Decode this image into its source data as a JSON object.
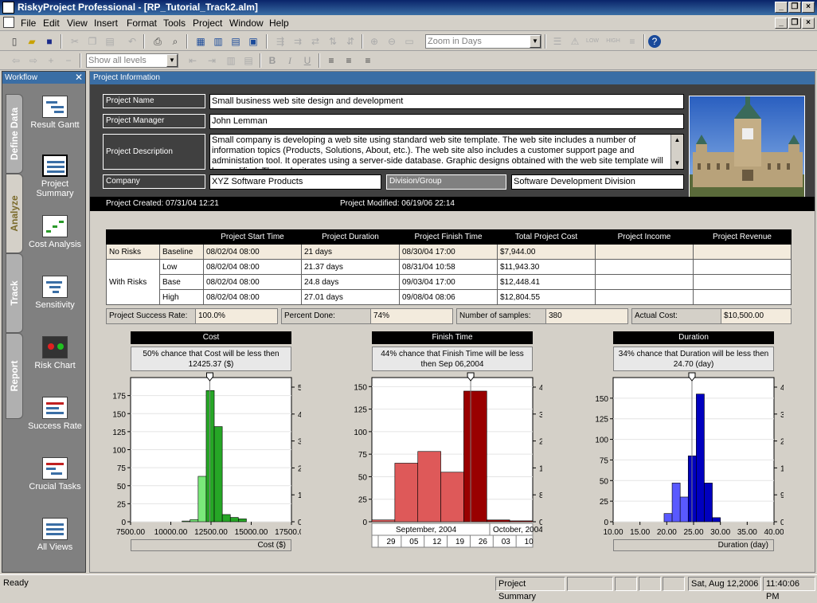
{
  "window": {
    "title": "RiskyProject Professional - [RP_Tutorial_Track2.alm]"
  },
  "menu": [
    "File",
    "Edit",
    "View",
    "Insert",
    "Format",
    "Tools",
    "Project",
    "Window",
    "Help"
  ],
  "toolbar": {
    "zoom_combo": "Zoom in Days",
    "levels_combo": "Show all levels",
    "bold": "B",
    "italic": "I",
    "underline": "U",
    "low": "LOW",
    "high": "HIGH"
  },
  "workflow": {
    "title": "Workflow",
    "tabs": [
      "Define Data",
      "Analyze",
      "Track",
      "Report"
    ],
    "items": [
      {
        "label": "Result Gantt"
      },
      {
        "label": "Project Summary"
      },
      {
        "label": "Cost Analysis"
      },
      {
        "label": "Sensitivity"
      },
      {
        "label": "Risk Chart"
      },
      {
        "label": "Success Rate"
      },
      {
        "label": "Crucial Tasks"
      },
      {
        "label": "All Views"
      }
    ]
  },
  "info": {
    "header": "Project Information",
    "project_name_label": "Project Name",
    "project_name": "Small business web site design and development",
    "manager_label": "Project Manager",
    "manager": "John Lemman",
    "description_label": "Project Description",
    "description": "Small company is developing a web site using standard web site template. The web site includes a number of information topics (Products, Solutions, About, etc.). The web site also includes a customer support page and administation tool. It operates using a server-side database. Graphic designs obtained with the web site template will be modified. The web site",
    "company_label": "Company",
    "company": "XYZ Software Products",
    "division_label": "Division/Group",
    "division": "Software Development Division",
    "created": "Project Created: 07/31/04 12:21",
    "modified": "Project Modified: 06/19/06 22:14"
  },
  "summary": {
    "headers": [
      "",
      "",
      "Project Start Time",
      "Project Duration",
      "Project Finish Time",
      "Total Project Cost",
      "Project Income",
      "Project Revenue"
    ],
    "rows": [
      {
        "group": "No Risks",
        "case": "Baseline",
        "start": "08/02/04 08:00",
        "duration": "21 days",
        "finish": "08/30/04 17:00",
        "cost": "$7,944.00",
        "income": "",
        "revenue": ""
      },
      {
        "group": "With Risks",
        "case": "Low",
        "start": "08/02/04 08:00",
        "duration": "21.37 days",
        "finish": "08/31/04 10:58",
        "cost": "$11,943.30",
        "income": "",
        "revenue": ""
      },
      {
        "group": "",
        "case": "Base",
        "start": "08/02/04 08:00",
        "duration": "24.8 days",
        "finish": "09/03/04 17:00",
        "cost": "$12,448.41",
        "income": "",
        "revenue": ""
      },
      {
        "group": "",
        "case": "High",
        "start": "08/02/04 08:00",
        "duration": "27.01 days",
        "finish": "09/08/04 08:06",
        "cost": "$12,804.55",
        "income": "",
        "revenue": ""
      }
    ]
  },
  "stats": {
    "success_label": "Project Success Rate:",
    "success": "100.0%",
    "done_label": "Percent Done:",
    "done": "74%",
    "samples_label": "Number of samples:",
    "samples": "380",
    "actual_label": "Actual Cost:",
    "actual": "$10,500.00"
  },
  "chart_data": [
    {
      "type": "bar",
      "title": "Cost",
      "note": "50% chance that Cost will be less then 12425.37 ($)",
      "xlabel": "Cost ($)",
      "x_ticks": [
        "7500.00",
        "10000.00",
        "12500.00",
        "15000.00",
        "17500.00"
      ],
      "xlim": [
        7500,
        17500
      ],
      "y_ticks": [
        "0",
        "25",
        "50",
        "75",
        "100",
        "125",
        "150",
        "175"
      ],
      "ylim": [
        0,
        200
      ],
      "y2_ticks": [
        "0%",
        "10%",
        "20%",
        "30%",
        "40%",
        "50%"
      ],
      "bins": [
        [
          10700,
          11200,
          1
        ],
        [
          11200,
          11700,
          3
        ],
        [
          11700,
          12200,
          63
        ],
        [
          12200,
          12700,
          182
        ],
        [
          12700,
          13200,
          132
        ],
        [
          13200,
          13700,
          10
        ],
        [
          13700,
          14200,
          6
        ],
        [
          14200,
          14700,
          4
        ]
      ],
      "color": "#33dd33",
      "marker": 12425
    },
    {
      "type": "bar",
      "title": "Finish Time",
      "note": "44% chance that Finish Time will be less then Sep 06,2004",
      "xlabel": "",
      "date_axis": {
        "month1": "September, 2004",
        "month2": "October, 2004",
        "days": [
          "29",
          "05",
          "12",
          "19",
          "26",
          "03",
          "10"
        ]
      },
      "y_ticks": [
        "0",
        "25",
        "50",
        "75",
        "100",
        "125",
        "150"
      ],
      "ylim": [
        0,
        160
      ],
      "y2_ticks": [
        "0%",
        "8%",
        "16%",
        "24%",
        "32%",
        "40%"
      ],
      "bins": [
        [
          0,
          1,
          2
        ],
        [
          1,
          2,
          65
        ],
        [
          2,
          3,
          78
        ],
        [
          3,
          4,
          55
        ],
        [
          4,
          5,
          145
        ],
        [
          5,
          6,
          2
        ],
        [
          6,
          7,
          1
        ]
      ],
      "color": "#cc0000",
      "marker": 4.3
    },
    {
      "type": "bar",
      "title": "Duration",
      "note": "34% chance that Duration will be less then 24.70 (day)",
      "xlabel": "Duration (day)",
      "x_ticks": [
        "10.00",
        "15.00",
        "20.00",
        "25.00",
        "30.00",
        "35.00",
        "40.00"
      ],
      "xlim": [
        10,
        40
      ],
      "y_ticks": [
        "0",
        "25",
        "50",
        "75",
        "100",
        "125",
        "150"
      ],
      "ylim": [
        0,
        175
      ],
      "y2_ticks": [
        "0%",
        "9%",
        "18%",
        "27%",
        "36%",
        "45%"
      ],
      "bins": [
        [
          19.5,
          21,
          10
        ],
        [
          21,
          22.5,
          47
        ],
        [
          22.5,
          24,
          30
        ],
        [
          24,
          25.5,
          80
        ],
        [
          25.5,
          27,
          155
        ],
        [
          27,
          28.5,
          47
        ],
        [
          28.5,
          30,
          5
        ]
      ],
      "color": "#0000ff",
      "marker": 24.7
    }
  ],
  "status": {
    "ready": "Ready",
    "view": "Project Summary",
    "date": "Sat, Aug 12,2006",
    "time": "11:40:06 PM"
  }
}
